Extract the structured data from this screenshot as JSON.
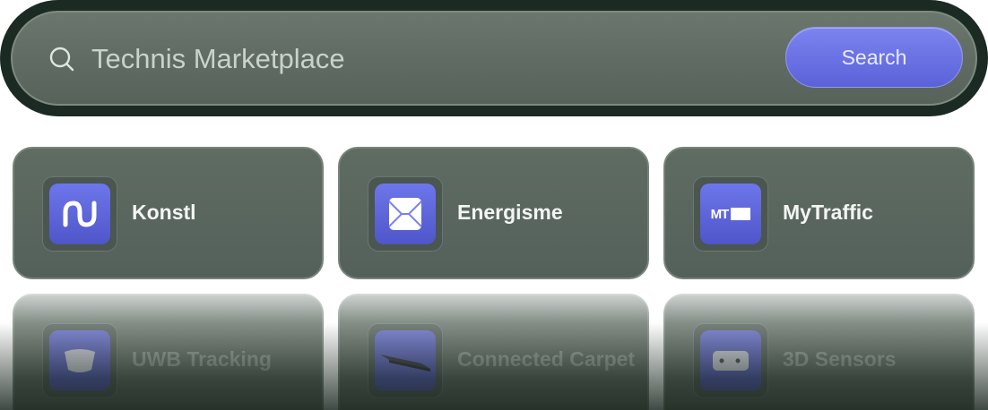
{
  "search": {
    "placeholder": "Technis Marketplace",
    "button_label": "Search",
    "icon": "search-icon"
  },
  "cards": [
    {
      "label": "Konstl",
      "icon": "konstl-logo-icon"
    },
    {
      "label": "Energisme",
      "icon": "energisme-logo-icon"
    },
    {
      "label": "MyTraffic",
      "icon": "mytraffic-logo-icon",
      "logo_text": "MT"
    },
    {
      "label": "UWB Tracking",
      "icon": "uwb-tag-icon"
    },
    {
      "label": "Connected Carpet",
      "icon": "carpet-icon"
    },
    {
      "label": "3D Sensors",
      "icon": "sensor-icon"
    }
  ],
  "colors": {
    "accent": "#6169dd",
    "card_bg": "#5a665e",
    "shell_bg": "#1b2a22"
  }
}
